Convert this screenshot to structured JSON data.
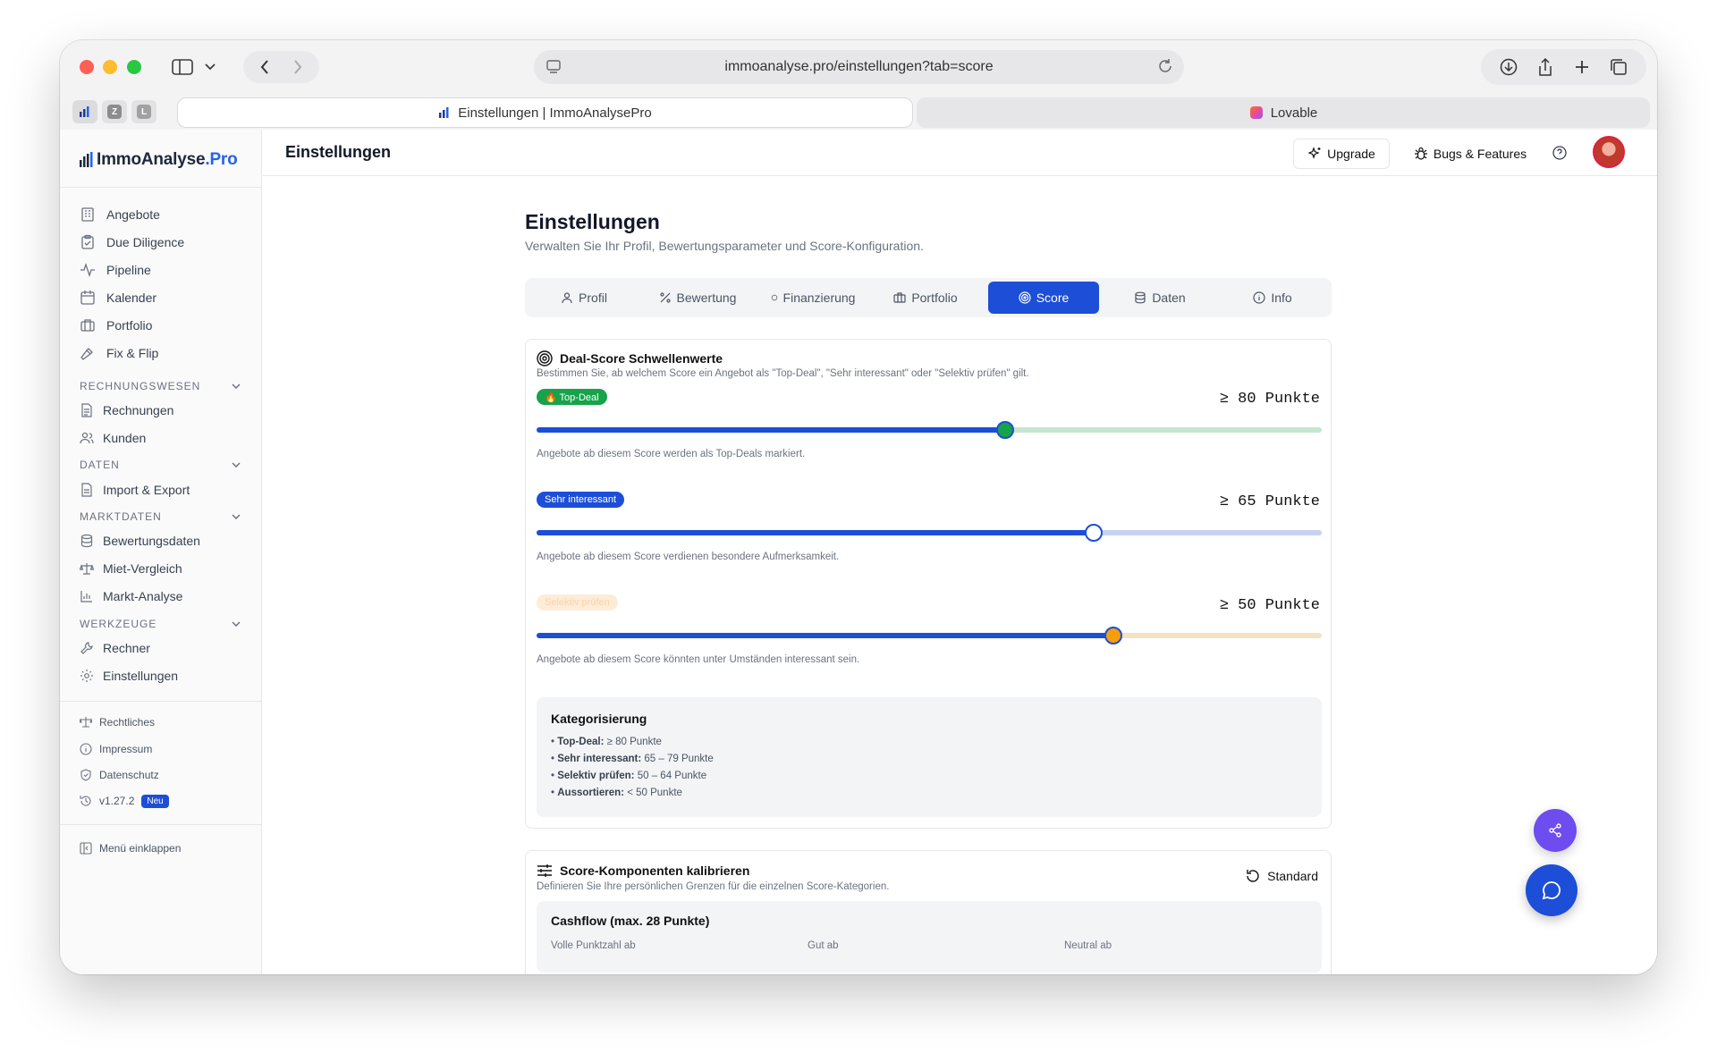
{
  "browser": {
    "url": "immoanalyse.pro/einstellungen?tab=score",
    "pinned_tabs": [
      "Z",
      "L"
    ],
    "active_tab_title": "Einstellungen | ImmoAnalysePro",
    "other_tab_title": "Lovable"
  },
  "sidebar": {
    "logo_main": "ImmoAnalyse",
    "logo_accent": ".Pro",
    "items": [
      {
        "label": "Angebote"
      },
      {
        "label": "Due Diligence"
      },
      {
        "label": "Pipeline"
      },
      {
        "label": "Kalender"
      },
      {
        "label": "Portfolio"
      },
      {
        "label": "Fix & Flip"
      }
    ],
    "sections": [
      {
        "title": "RECHNUNGSWESEN",
        "items": [
          "Rechnungen",
          "Kunden"
        ]
      },
      {
        "title": "DATEN",
        "items": [
          "Import & Export"
        ]
      },
      {
        "title": "MARKTDATEN",
        "items": [
          "Bewertungsdaten",
          "Miet-Vergleich",
          "Markt-Analyse"
        ]
      },
      {
        "title": "WERKZEUGE",
        "items": [
          "Rechner",
          "Einstellungen"
        ]
      }
    ],
    "footer_links": [
      "Rechtliches",
      "Impressum",
      "Datenschutz"
    ],
    "version": "v1.27.2",
    "version_badge": "Neu",
    "collapse_label": "Menü einklappen"
  },
  "topbar": {
    "title": "Einstellungen",
    "upgrade_label": "Upgrade",
    "bugs_label": "Bugs & Features"
  },
  "page": {
    "title": "Einstellungen",
    "subtitle": "Verwalten Sie Ihr Profil, Bewertungsparameter und Score-Konfiguration.",
    "tabs": [
      "Profil",
      "Bewertung",
      "Finanzierung",
      "Portfolio",
      "Score",
      "Daten",
      "Info"
    ],
    "active_tab": "Score"
  },
  "deal_score": {
    "title": "Deal-Score Schwellenwerte",
    "description": "Bestimmen Sie, ab welchem Score ein Angebot als \"Top-Deal\", \"Sehr interessant\" oder \"Selektiv prüfen\" gilt.",
    "thresholds": [
      {
        "badge": "🔥 Top-Deal",
        "points_label": "≥ 80 Punkte",
        "value": 80,
        "slider_fraction": 0.597,
        "note": "Angebote ab diesem Score werden als Top-Deals markiert.",
        "color": "#16a34a"
      },
      {
        "badge": "Sehr interessant",
        "points_label": "≥ 65 Punkte",
        "value": 65,
        "slider_fraction": 0.709,
        "note": "Angebote ab diesem Score verdienen besondere Aufmerksamkeit.",
        "color": "#1d4ed8"
      },
      {
        "badge": "Selektiv prüfen",
        "points_label": "≥ 50 Punkte",
        "value": 50,
        "slider_fraction": 0.735,
        "note": "Angebote ab diesem Score könnten unter Umständen interessant sein.",
        "color": "#f59e0b"
      }
    ],
    "categorization": {
      "title": "Kategorisierung",
      "lines": [
        {
          "label": "Top-Deal:",
          "value": "≥ 80 Punkte"
        },
        {
          "label": "Sehr interessant:",
          "value": "65 – 79 Punkte"
        },
        {
          "label": "Selektiv prüfen:",
          "value": "50 – 64 Punkte"
        },
        {
          "label": "Aussortieren:",
          "value": "< 50 Punkte"
        }
      ]
    }
  },
  "components": {
    "title": "Score-Komponenten kalibrieren",
    "description": "Definieren Sie Ihre persönlichen Grenzen für die einzelnen Score-Kategorien.",
    "reset_label": "Standard",
    "cashflow_title": "Cashflow (max. 28 Punkte)",
    "cashflow_columns": [
      "Volle Punktzahl ab",
      "Gut ab",
      "Neutral ab"
    ]
  }
}
